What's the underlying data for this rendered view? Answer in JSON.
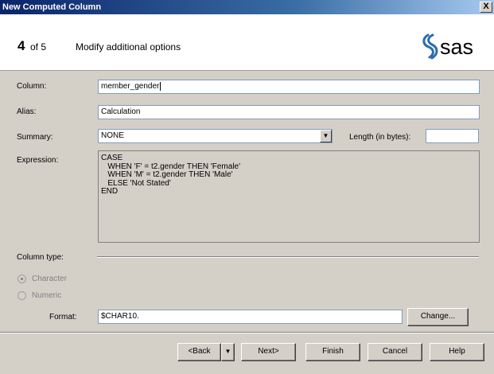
{
  "window": {
    "title": "New Computed Column",
    "close_label": "X"
  },
  "header": {
    "step_number": "4",
    "step_of": "of 5",
    "step_description": "Modify additional options",
    "logo_text": "sas"
  },
  "form": {
    "column_label": "Column:",
    "column_value": "member_gender",
    "alias_label": "Alias:",
    "alias_value": "Calculation",
    "summary_label": "Summary:",
    "summary_value": "NONE",
    "length_label": "Length (in bytes):",
    "length_value": "",
    "expression_label": "Expression:",
    "expression_lines": [
      "CASE",
      "   WHEN 'F' = t2.gender THEN 'Female'",
      "   WHEN 'M' = t2.gender THEN 'Male'",
      "   ELSE 'Not Stated'",
      "END"
    ],
    "column_type_label": "Column type:",
    "type_options": [
      {
        "label": "Character",
        "selected": true
      },
      {
        "label": "Numeric",
        "selected": false
      }
    ],
    "format_label": "Format:",
    "format_value": "$CHAR10.",
    "change_label": "Change..."
  },
  "footer": {
    "back_label": "<Back",
    "next_label": "Next>",
    "finish_label": "Finish",
    "cancel_label": "Cancel",
    "help_label": "Help"
  },
  "colors": {
    "titlebar": "#0a246a",
    "logo": "#2b6cb0",
    "face": "#d4d0c8"
  }
}
